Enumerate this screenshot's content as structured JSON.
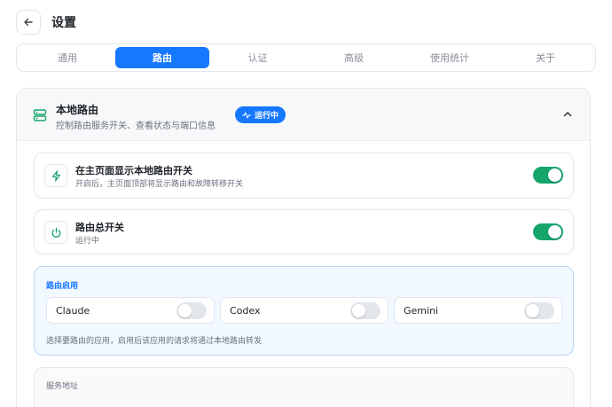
{
  "header": {
    "title": "设置",
    "back_icon": "arrow-left-icon"
  },
  "tabs": [
    {
      "label": "通用",
      "active": false
    },
    {
      "label": "路由",
      "active": true
    },
    {
      "label": "认证",
      "active": false
    },
    {
      "label": "高级",
      "active": false
    },
    {
      "label": "使用统计",
      "active": false
    },
    {
      "label": "关于",
      "active": false
    }
  ],
  "panel": {
    "title": "本地路由",
    "subtitle": "控制路由服务开关、查看状态与端口信息",
    "status": "运行中",
    "icon": "server-icon",
    "collapse_icon": "chevron-up-icon"
  },
  "settings": [
    {
      "title": "在主页面显示本地路由开关",
      "subtitle": "开启后，主页面顶部将显示路由和故障转移开关",
      "icon": "lightning-icon",
      "enabled": true
    },
    {
      "title": "路由总开关",
      "subtitle": "运行中",
      "icon": "power-icon",
      "enabled": true
    }
  ],
  "apps": {
    "title": "路由启用",
    "items": [
      {
        "name": "Claude",
        "enabled": false
      },
      {
        "name": "Codex",
        "enabled": false
      },
      {
        "name": "Gemini",
        "enabled": false
      }
    ],
    "note": "选择要路由的应用，启用后该应用的请求将通过本地路由转发"
  },
  "service": {
    "label": "服务地址"
  },
  "colors": {
    "accent": "#1677ff",
    "toggle_on": "#16a56b",
    "toggle_off": "#e3e6ea"
  }
}
